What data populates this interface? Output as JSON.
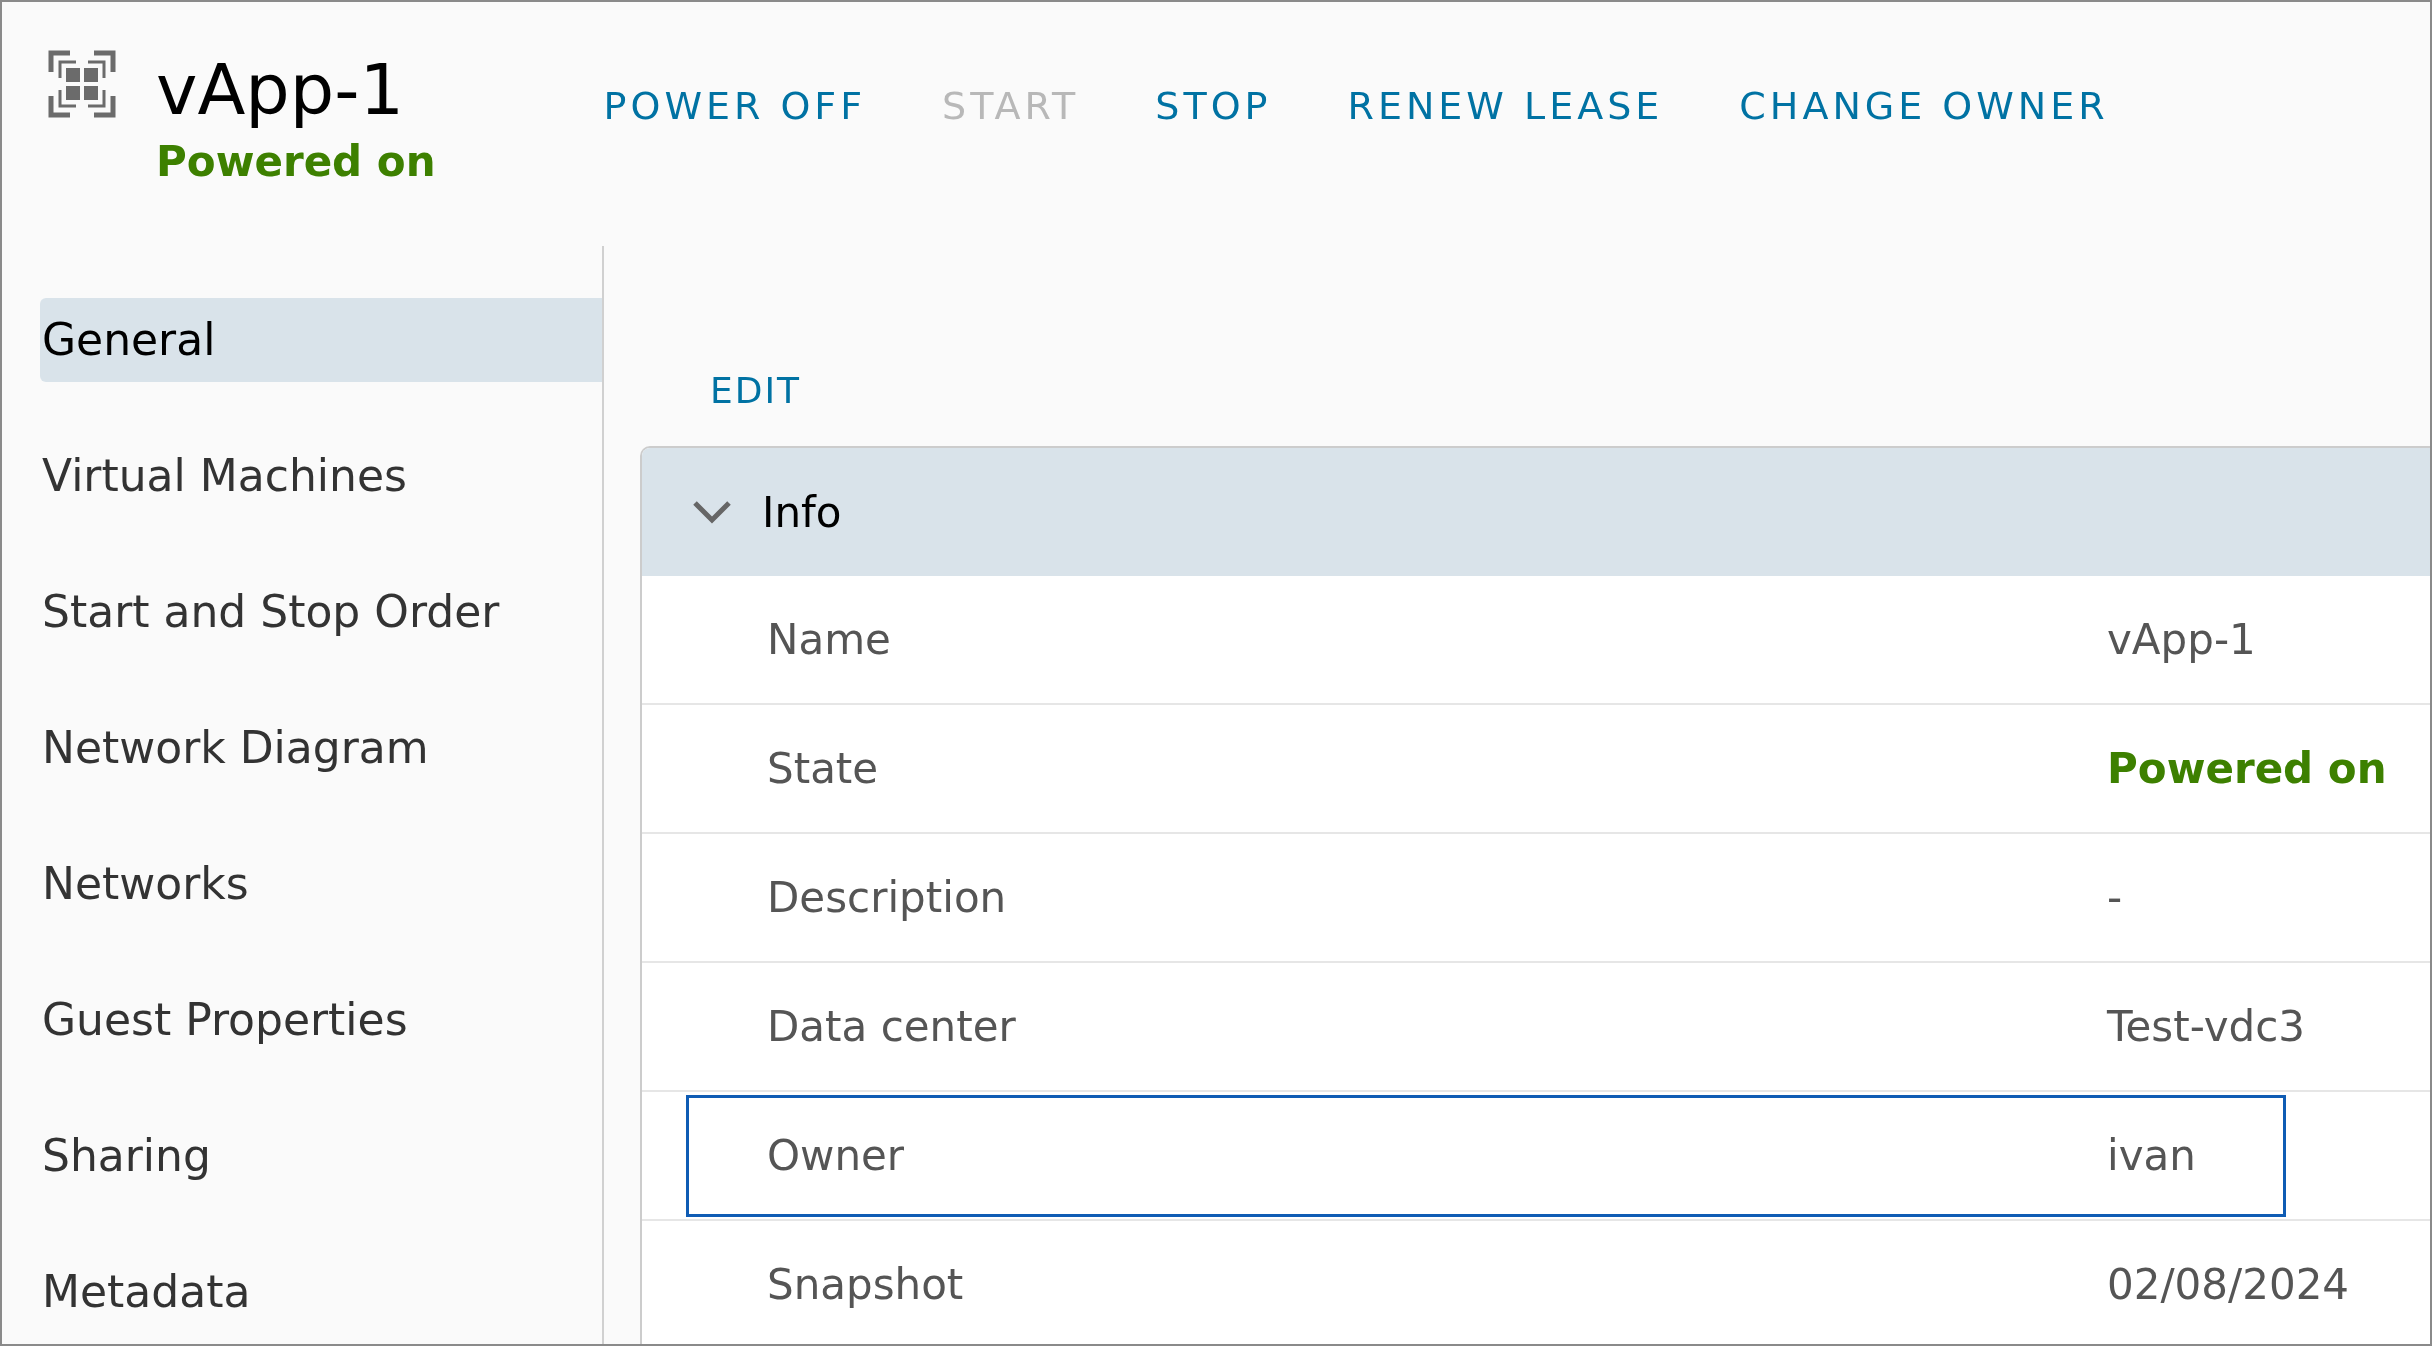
{
  "header": {
    "title": "vApp-1",
    "status": "Powered on"
  },
  "actions": [
    {
      "label": "POWER OFF",
      "disabled": false
    },
    {
      "label": "START",
      "disabled": true
    },
    {
      "label": "STOP",
      "disabled": false
    },
    {
      "label": "RENEW LEASE",
      "disabled": false
    },
    {
      "label": "CHANGE OWNER",
      "disabled": false
    }
  ],
  "sidebar": {
    "items": [
      {
        "label": "General",
        "selected": true
      },
      {
        "label": "Virtual Machines",
        "selected": false
      },
      {
        "label": "Start and Stop Order",
        "selected": false
      },
      {
        "label": "Network Diagram",
        "selected": false
      },
      {
        "label": "Networks",
        "selected": false
      },
      {
        "label": "Guest Properties",
        "selected": false
      },
      {
        "label": "Sharing",
        "selected": false
      },
      {
        "label": "Metadata",
        "selected": false
      }
    ]
  },
  "edit_link": "EDIT",
  "info": {
    "title": "Info",
    "expanded": true,
    "rows": [
      {
        "label": "Name",
        "value": "vApp-1",
        "kind": "text",
        "focused": false
      },
      {
        "label": "State",
        "value": "Powered on",
        "kind": "status",
        "focused": false
      },
      {
        "label": "Description",
        "value": "-",
        "kind": "text",
        "focused": false
      },
      {
        "label": "Data center",
        "value": "Test-vdc3",
        "kind": "text",
        "focused": false
      },
      {
        "label": "Owner",
        "value": "ivan",
        "kind": "text",
        "focused": true
      },
      {
        "label": "Snapshot",
        "value": "02/08/2024",
        "kind": "text",
        "focused": false
      }
    ]
  }
}
